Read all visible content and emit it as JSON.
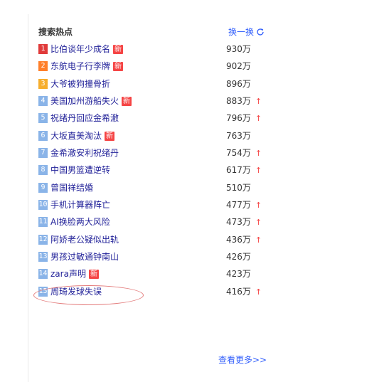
{
  "panel": {
    "title": "搜索热点",
    "refresh_label": "换一换",
    "refresh_icon": "refresh-icon",
    "more_label": "查看更多>>"
  },
  "items": [
    {
      "rank": "1",
      "text": "比伯谈年少成名",
      "badge": "新",
      "count": "930万",
      "up": ""
    },
    {
      "rank": "2",
      "text": "东航电子行李牌",
      "badge": "新",
      "count": "902万",
      "up": ""
    },
    {
      "rank": "3",
      "text": "大爷被狗撞骨折",
      "badge": "",
      "count": "896万",
      "up": ""
    },
    {
      "rank": "4",
      "text": "美国加州游船失火",
      "badge": "新",
      "count": "883万",
      "up": "↑"
    },
    {
      "rank": "5",
      "text": "祝绪丹回应金希澈",
      "badge": "",
      "count": "796万",
      "up": "↑"
    },
    {
      "rank": "6",
      "text": "大坂直美淘汰",
      "badge": "新",
      "count": "763万",
      "up": ""
    },
    {
      "rank": "7",
      "text": "金希澈安利祝绪丹",
      "badge": "",
      "count": "754万",
      "up": "↑"
    },
    {
      "rank": "8",
      "text": "中国男篮遭逆转",
      "badge": "",
      "count": "617万",
      "up": "↑"
    },
    {
      "rank": "9",
      "text": "曾国祥结婚",
      "badge": "",
      "count": "510万",
      "up": ""
    },
    {
      "rank": "10",
      "text": "手机计算器阵亡",
      "badge": "",
      "count": "477万",
      "up": "↑"
    },
    {
      "rank": "11",
      "text": "AI换脸两大风险",
      "badge": "",
      "count": "473万",
      "up": "↑"
    },
    {
      "rank": "12",
      "text": "阿娇老公疑似出轨",
      "badge": "",
      "count": "436万",
      "up": "↑"
    },
    {
      "rank": "13",
      "text": "男孩过敏通钟南山",
      "badge": "",
      "count": "426万",
      "up": ""
    },
    {
      "rank": "14",
      "text": "zara声明",
      "badge": "新",
      "count": "423万",
      "up": ""
    },
    {
      "rank": "15",
      "text": "周琦发球失误",
      "badge": "",
      "count": "416万",
      "up": "↑"
    }
  ],
  "colors": {
    "rank1": "#e03a3a",
    "rank2": "#ff7f2a",
    "rank3": "#f6ae2d",
    "rank_other": "#8ab4e8",
    "link": "#222299",
    "accent": "#315efb",
    "badge": "#f54545",
    "annotation": "#e37a7a"
  }
}
